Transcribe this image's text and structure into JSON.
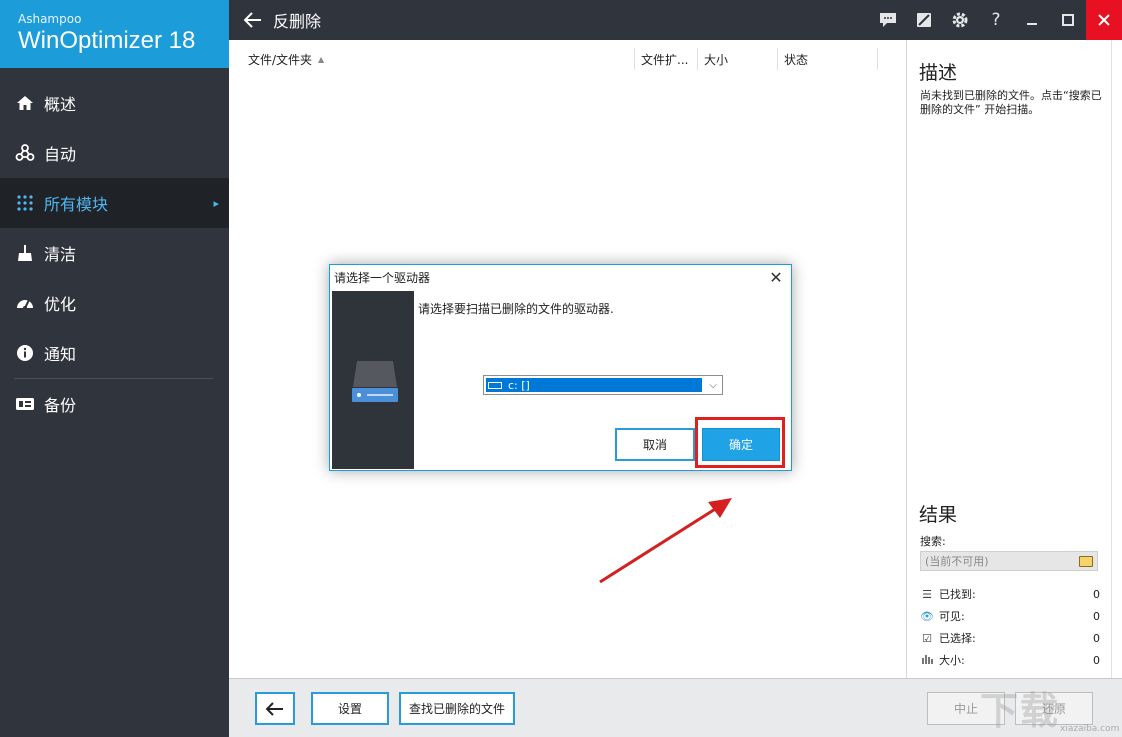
{
  "app": {
    "brand": "Ashampoo",
    "product": "WinOptimizer 18"
  },
  "sidebar": {
    "items": [
      {
        "label": "概述",
        "icon": "home-icon"
      },
      {
        "label": "自动",
        "icon": "automation-icon"
      },
      {
        "label": "所有模块",
        "icon": "grid-icon",
        "active": true
      },
      {
        "label": "清洁",
        "icon": "broom-icon"
      },
      {
        "label": "优化",
        "icon": "speedometer-icon"
      },
      {
        "label": "通知",
        "icon": "info-icon"
      },
      {
        "label": "备份",
        "icon": "backup-icon"
      }
    ]
  },
  "titlebar": {
    "title": "反删除"
  },
  "table": {
    "columns": [
      "文件/文件夹",
      "文件扩...",
      "大小",
      "状态"
    ]
  },
  "rightpanel": {
    "desc_title": "描述",
    "desc_text": "尚未找到已删除的文件。点击“搜索已删除的文件” 开始扫描。",
    "results_title": "结果",
    "search_label": "搜索:",
    "search_placeholder": "(当前不可用)",
    "stats": [
      {
        "label": "已找到:",
        "value": "0",
        "icon": "list-icon"
      },
      {
        "label": "可见:",
        "value": "0",
        "icon": "eye-icon"
      },
      {
        "label": "已选择:",
        "value": "0",
        "icon": "check-icon"
      },
      {
        "label": "大小:",
        "value": "0",
        "icon": "bar-chart-icon"
      }
    ]
  },
  "footer": {
    "settings": "设置",
    "find": "查找已删除的文件",
    "stop": "中止",
    "restore": "还原"
  },
  "dialog": {
    "title": "请选择一个驱动器",
    "message": "请选择要扫描已删除的文件的驱动器.",
    "selected_drive": "c: []",
    "cancel": "取消",
    "ok": "确定"
  },
  "watermark": {
    "text": "下载",
    "sub": "xiazaiba.com"
  },
  "colors": {
    "accent": "#1c9cd9",
    "sidebar_bg": "#30353d",
    "highlight": "#e02020",
    "close_red": "#e81123"
  }
}
